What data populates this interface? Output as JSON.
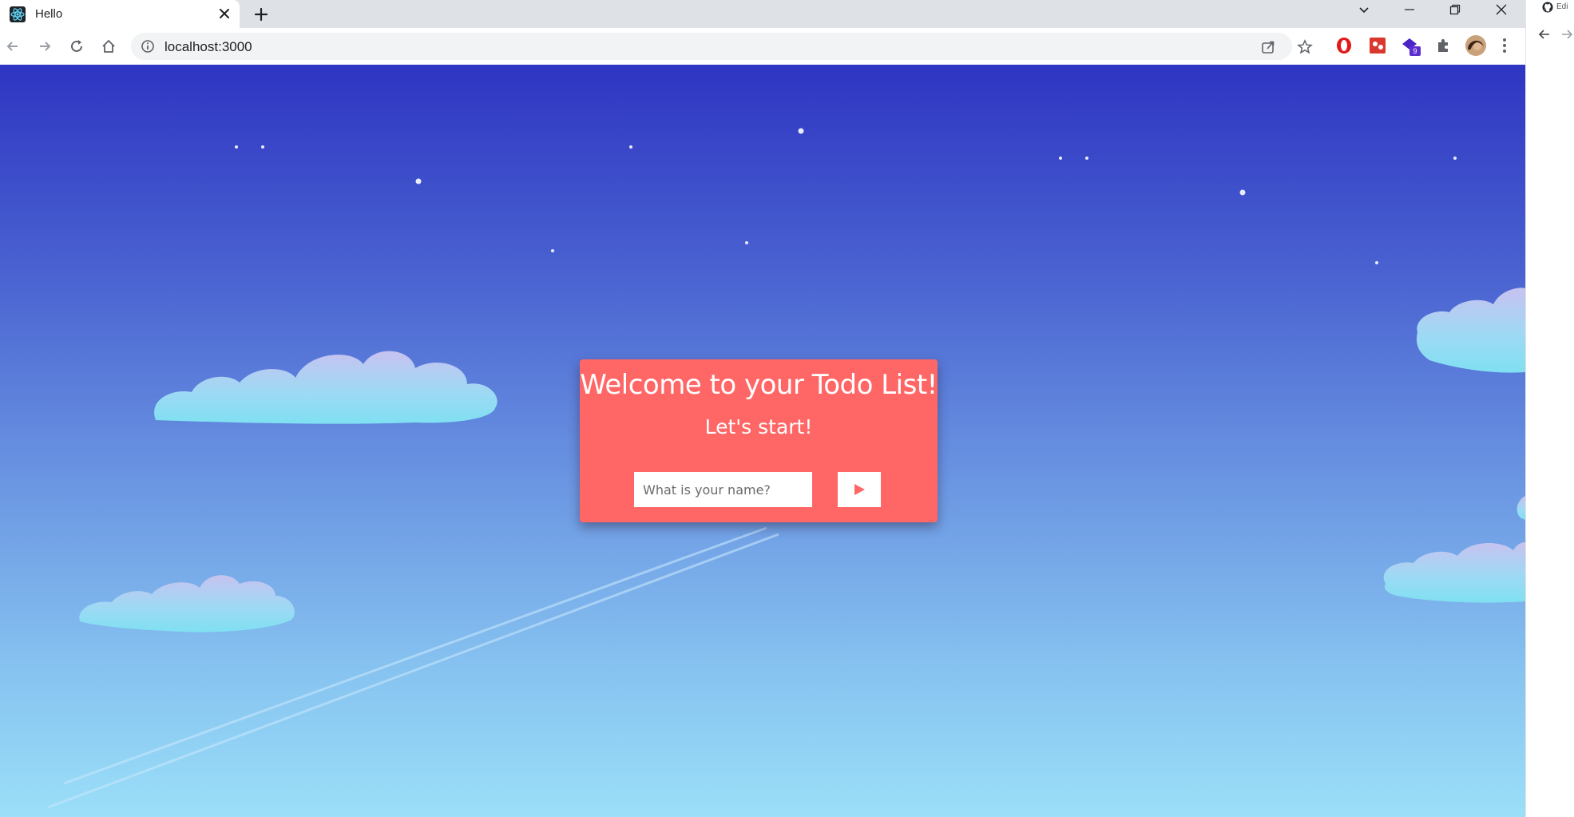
{
  "browser": {
    "tab": {
      "title": "Hello",
      "favicon": "react-logo-icon"
    },
    "new_tab_icon": "plus-icon",
    "window_controls": [
      "tab-search-icon",
      "minimize-icon",
      "restore-icon",
      "close-icon"
    ],
    "nav": [
      "back-icon",
      "forward-icon",
      "reload-icon",
      "home-icon"
    ],
    "address_bar": {
      "url": "localhost:3000",
      "site_info_icon": "info-icon"
    },
    "omnibox_actions": [
      "share-icon",
      "bookmark-star-icon"
    ],
    "extensions": [
      {
        "name": "opera-extension-icon",
        "color": "#e01a1a"
      },
      {
        "name": "red-extension-icon",
        "color": "#d9382f"
      },
      {
        "name": "purple-extension-icon",
        "color": "#4b24c6",
        "badge": "9"
      },
      {
        "name": "extensions-puzzle-icon"
      }
    ],
    "profile_avatar": "avatar",
    "menu_icon": "kebab-menu-icon"
  },
  "side_panel": {
    "label": "Edi"
  },
  "page": {
    "sky_colors": {
      "top": "#2e35c2",
      "bottom": "#9bdff8"
    },
    "card": {
      "background": "#ff6666",
      "title": "Welcome to your Todo List!",
      "subtitle": "Let's start!",
      "input_placeholder": "What is your name?",
      "input_value": "",
      "submit_icon": "play-icon"
    }
  }
}
